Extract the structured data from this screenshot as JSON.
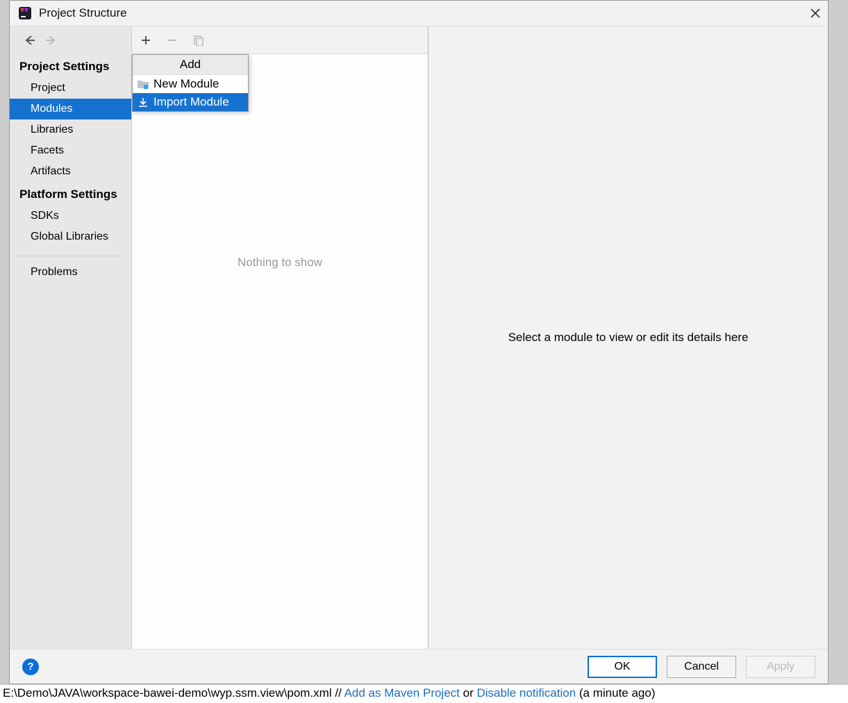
{
  "window": {
    "title": "Project Structure"
  },
  "sidebar": {
    "sections": [
      {
        "header": "Project Settings",
        "items": [
          "Project",
          "Modules",
          "Libraries",
          "Facets",
          "Artifacts"
        ],
        "selected_index": 1
      },
      {
        "header": "Platform Settings",
        "items": [
          "SDKs",
          "Global Libraries"
        ]
      }
    ],
    "problems_label": "Problems"
  },
  "middle": {
    "empty_text": "Nothing to show",
    "popup": {
      "title": "Add",
      "items": [
        {
          "label": "New Module",
          "icon": "folder-module-icon"
        },
        {
          "label": "Import Module",
          "icon": "import-icon"
        }
      ],
      "selected_index": 1
    }
  },
  "right": {
    "placeholder": "Select a module to view or edit its details here"
  },
  "buttons": {
    "ok": "OK",
    "cancel": "Cancel",
    "apply": "Apply",
    "help": "?"
  },
  "status": {
    "path_prefix": "E:\\Demo\\JAVA\\workspace-bawei-demo\\wyp.ssm.view\\pom.xml // ",
    "link1": "Add as Maven Project",
    "mid": " or ",
    "link2": "Disable notification",
    "suffix": " (a minute ago)"
  }
}
